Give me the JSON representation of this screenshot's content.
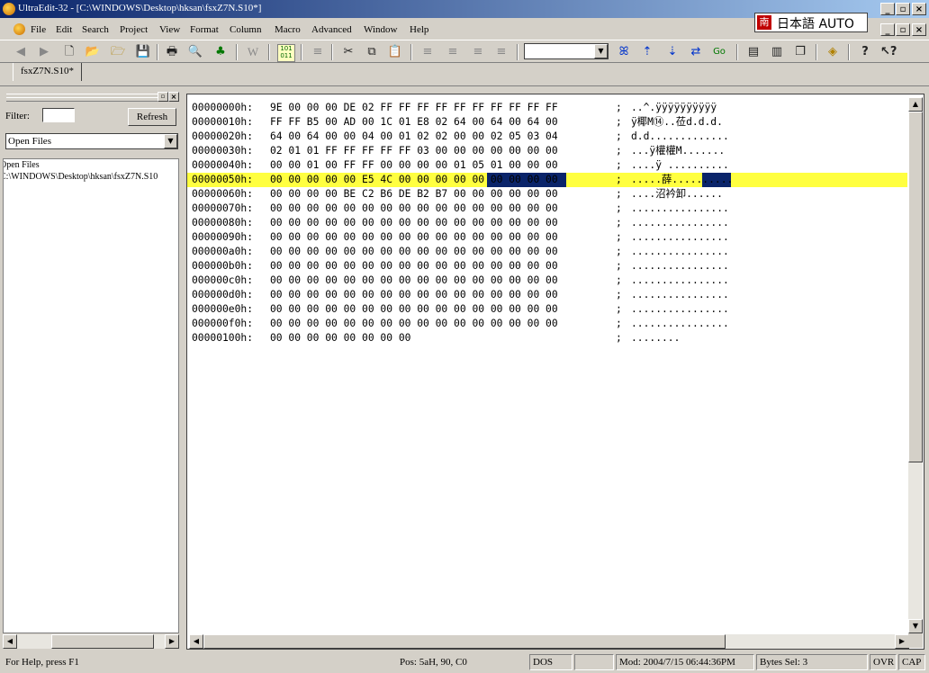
{
  "title": "UltraEdit-32 - [C:\\WINDOWS\\Desktop\\hksan\\fsxZ7N.S10*]",
  "ime": {
    "label": "日本語 AUTO",
    "icon": "南"
  },
  "menu": [
    {
      "label": "File"
    },
    {
      "label": "Edit"
    },
    {
      "label": "Search"
    },
    {
      "label": "Project"
    },
    {
      "label": "View"
    },
    {
      "label": "Format"
    },
    {
      "label": "Column"
    },
    {
      "label": "Macro"
    },
    {
      "label": "Advanced"
    },
    {
      "label": "Window"
    },
    {
      "label": "Help"
    }
  ],
  "tab": {
    "label": "fsxZ7N.S10*"
  },
  "left_pane": {
    "filter_label": "Filter:",
    "filter_value": "",
    "refresh_label": "Refresh",
    "open_files_label": "Open Files",
    "list_header": "Open Files",
    "list_items": [
      "C:\\WINDOWS\\Desktop\\hksan\\fsxZ7N.S10"
    ]
  },
  "hex_rows": [
    {
      "addr": "00000000h:",
      "hex": "9E 00 00 00 DE 02 FF FF FF FF FF FF FF FF FF FF",
      "ascii": "..^.ÿÿÿÿÿÿÿÿÿÿ"
    },
    {
      "addr": "00000010h:",
      "hex": "FF FF B5 00 AD 00 1C 01 E8 02 64 00 64 00 64 00",
      "ascii": "ÿ椰M⑭..莅d.d.d."
    },
    {
      "addr": "00000020h:",
      "hex": "64 00 64 00 00 04 00 01 02 02 00 00 02 05 03 04",
      "ascii": "d.d............."
    },
    {
      "addr": "00000030h:",
      "hex": "02 01 01 FF FF FF FF FF 03 00 00 00 00 00 00 00",
      "ascii": "...ÿ權權M......."
    },
    {
      "addr": "00000040h:",
      "hex": "00 00 01 00 FF FF 00 00 00 00 01 05 01 00 00 00",
      "ascii": "....ÿ .........."
    },
    {
      "addr": "00000050h:",
      "hex": "00 00 00 00 00 E5 4C 00 00 00 00 00 00 00 00 00",
      "ascii": ".....薛.........."
    },
    {
      "addr": "00000060h:",
      "hex": "00 00 00 00 BE C2 B6 DE B2 B7 00 00 00 00 00 00",
      "ascii": "....沼衿卸......"
    },
    {
      "addr": "00000070h:",
      "hex": "00 00 00 00 00 00 00 00 00 00 00 00 00 00 00 00",
      "ascii": "................"
    },
    {
      "addr": "00000080h:",
      "hex": "00 00 00 00 00 00 00 00 00 00 00 00 00 00 00 00",
      "ascii": "................"
    },
    {
      "addr": "00000090h:",
      "hex": "00 00 00 00 00 00 00 00 00 00 00 00 00 00 00 00",
      "ascii": "................"
    },
    {
      "addr": "000000a0h:",
      "hex": "00 00 00 00 00 00 00 00 00 00 00 00 00 00 00 00",
      "ascii": "................"
    },
    {
      "addr": "000000b0h:",
      "hex": "00 00 00 00 00 00 00 00 00 00 00 00 00 00 00 00",
      "ascii": "................"
    },
    {
      "addr": "000000c0h:",
      "hex": "00 00 00 00 00 00 00 00 00 00 00 00 00 00 00 00",
      "ascii": "................"
    },
    {
      "addr": "000000d0h:",
      "hex": "00 00 00 00 00 00 00 00 00 00 00 00 00 00 00 00",
      "ascii": "................"
    },
    {
      "addr": "000000e0h:",
      "hex": "00 00 00 00 00 00 00 00 00 00 00 00 00 00 00 00",
      "ascii": "................"
    },
    {
      "addr": "000000f0h:",
      "hex": "00 00 00 00 00 00 00 00 00 00 00 00 00 00 00 00",
      "ascii": "................"
    },
    {
      "addr": "00000100h:",
      "hex": "00 00 00 00 00 00 00 00",
      "ascii": "........"
    }
  ],
  "highlight_row": 5,
  "status": {
    "help": "For Help, press F1",
    "pos": "Pos: 5aH, 90, C0",
    "format": "DOS",
    "blank": "",
    "mod": "Mod: 2004/7/15 06:44:36PM",
    "bytes_sel": "Bytes Sel: 3",
    "ovr": "OVR",
    "cap": "CAP"
  },
  "colors": {
    "title_start": "#0a246a",
    "title_end": "#a6caf0",
    "highlight": "#ffff40",
    "selection": "#0a246a"
  },
  "icons": [
    "back-icon",
    "forward-icon",
    "new-file-icon",
    "open-icon",
    "open-folder-icon",
    "save-icon",
    "print-icon",
    "print-preview-icon",
    "spell-check-icon",
    "word-wrap-icon",
    "hex-mode-icon",
    "align-icon",
    "cut-icon",
    "copy-icon",
    "paste-icon",
    "align-left-icon",
    "align-center-icon",
    "align-right-icon",
    "justify-icon",
    "find-icon",
    "find-prev-icon",
    "find-next-icon",
    "replace-icon",
    "goto-icon",
    "window-icon",
    "split-icon",
    "cascade-icon",
    "tag-icon",
    "help-icon",
    "context-help-icon"
  ]
}
